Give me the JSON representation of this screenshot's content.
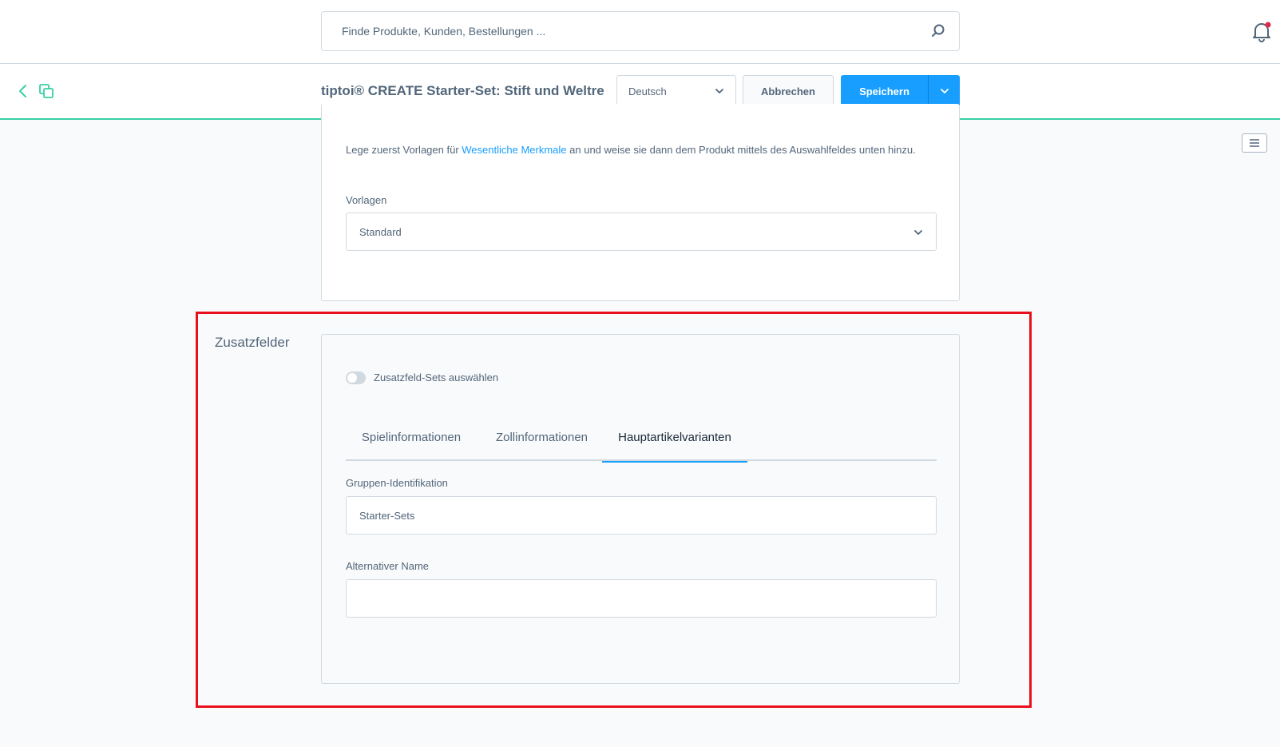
{
  "topbar": {
    "search_placeholder": "Finde Produkte, Kunden, Bestellungen ..."
  },
  "actionbar": {
    "title": "tiptoi® CREATE Starter-Set: Stift und Weltrei…",
    "language": "Deutsch",
    "cancel_label": "Abbrechen",
    "save_label": "Speichern"
  },
  "essential_features": {
    "description_before": "Lege zuerst Vorlagen für ",
    "description_link": "Wesentliche Merkmale",
    "description_after": " an und weise sie dann dem Produkt mittels des Auswahlfeldes unten hinzu.",
    "templates_label": "Vorlagen",
    "templates_value": "Standard"
  },
  "custom_fields": {
    "section_title": "Zusatzfelder",
    "toggle_label": "Zusatzfeld-Sets auswählen",
    "toggle_on": false,
    "tabs": [
      {
        "label": "Spielinformationen",
        "active": false
      },
      {
        "label": "Zollinformationen",
        "active": false
      },
      {
        "label": "Hauptartikelvarianten",
        "active": true
      }
    ],
    "group_id_label": "Gruppen-Identifikation",
    "group_id_value": "Starter-Sets",
    "alt_name_label": "Alternativer Name",
    "alt_name_value": ""
  },
  "colors": {
    "accent": "#189eff",
    "brand_line": "#37d0a5",
    "highlight": "#e8101a"
  }
}
